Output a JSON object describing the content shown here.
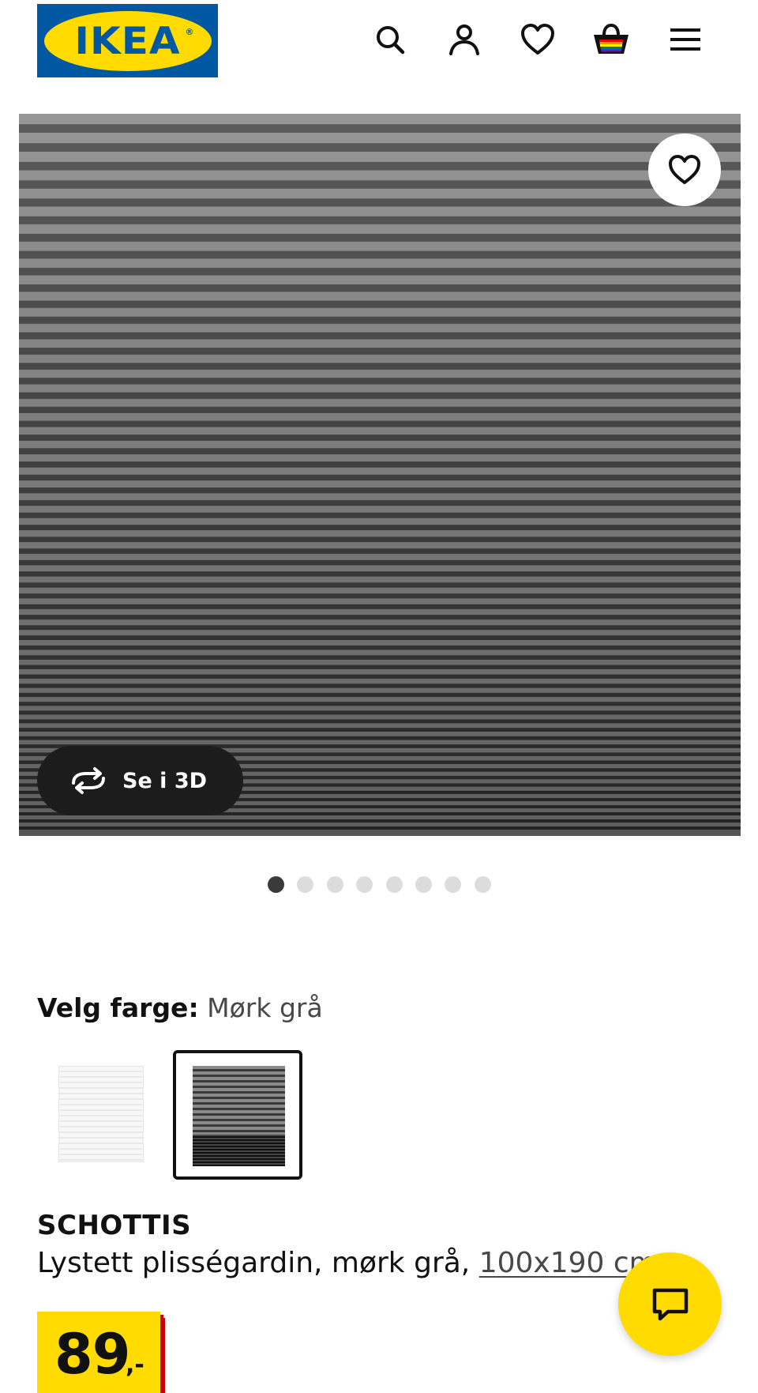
{
  "header": {
    "logo_text": "IKEA",
    "icons": [
      "search-icon",
      "account-icon",
      "wishlist-icon",
      "cart-icon",
      "menu-icon"
    ]
  },
  "gallery": {
    "view_3d_label": "Se i 3D",
    "image_count": 8,
    "active_index": 0
  },
  "color_selection": {
    "label": "Velg farge:",
    "value": "Mørk grå",
    "options": [
      "white",
      "dark grey"
    ],
    "selected": "dark grey"
  },
  "product": {
    "name": "SCHOTTIS",
    "description": "Lystett plisségardin, mørk grå,",
    "size_link": "100x190 cm"
  },
  "price": {
    "integer": "89",
    "suffix": ",-"
  },
  "colors": {
    "brand_blue": "#0058a3",
    "brand_yellow": "#ffdb00",
    "price_red": "#cc0008"
  }
}
